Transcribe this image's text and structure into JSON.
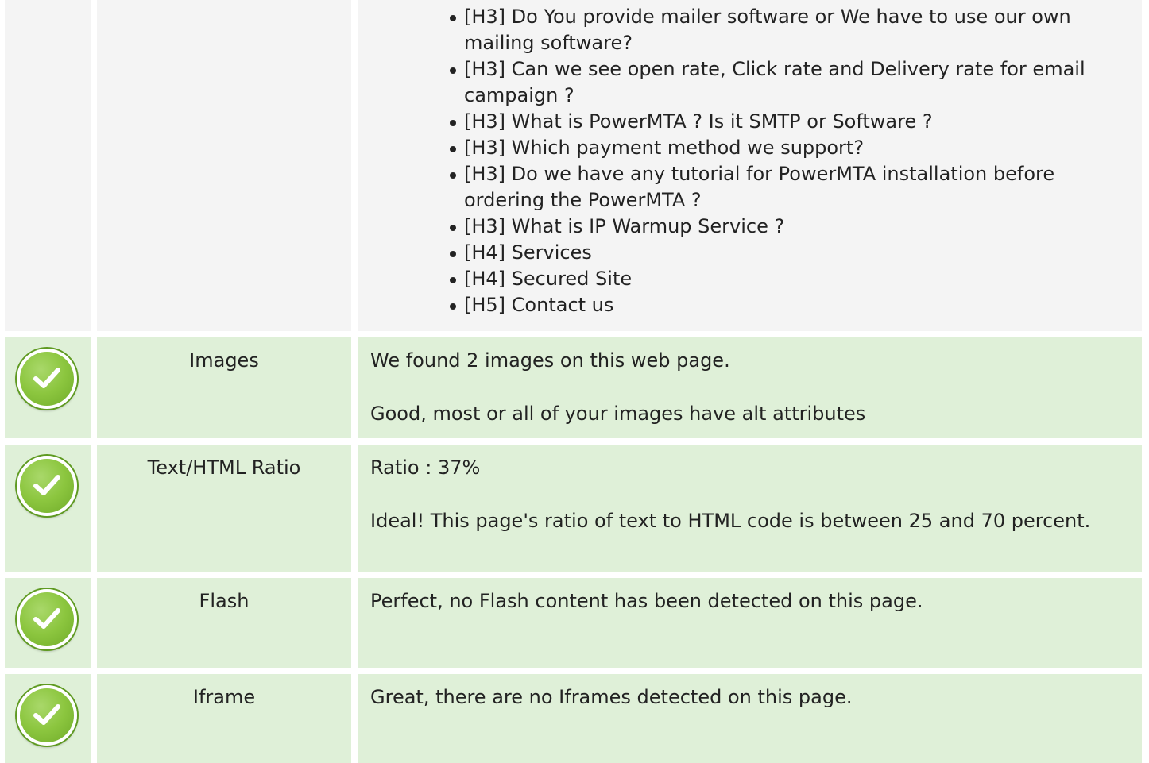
{
  "headings": {
    "items": [
      "[H3] Do You provide mailer software or We have to use our own mailing software?",
      "[H3] Can we see open rate, Click rate and Delivery rate for email campaign ?",
      "[H3] What is PowerMTA ? Is it SMTP or Software ?",
      "[H3] Which payment method we support?",
      "[H3] Do we have any tutorial for PowerMTA installation before ordering the PowerMTA ?",
      "[H3] What is IP Warmup Service ?",
      "[H4] Services",
      "[H4] Secured Site",
      "[H5] Contact us"
    ]
  },
  "checks": [
    {
      "icon": "check-circle-icon",
      "name": "Images",
      "line1": "We found 2 images on this web page.",
      "line2": "Good, most or all of your images have alt attributes"
    },
    {
      "icon": "check-circle-icon",
      "name": "Text/HTML Ratio",
      "line1": "Ratio : 37%",
      "line2": "Ideal! This page's ratio of text to HTML code is between 25 and 70 percent."
    },
    {
      "icon": "check-circle-icon",
      "name": "Flash",
      "line1": "Perfect, no Flash content has been detected on this page."
    },
    {
      "icon": "check-circle-icon",
      "name": "Iframe",
      "line1": "Great, there are no Iframes detected on this page."
    }
  ],
  "colors": {
    "pass_row": "#dff0d8",
    "neutral_row": "#f4f4f4",
    "check_green": "#8cc63f"
  }
}
